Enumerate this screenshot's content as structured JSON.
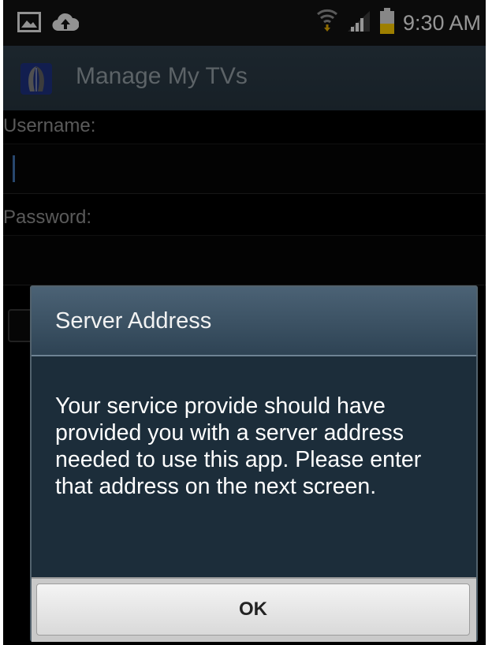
{
  "status_bar": {
    "time": "9:30 AM",
    "left_icons": [
      "gallery-icon",
      "cloud-upload-icon"
    ],
    "right_icons": [
      "wifi-icon",
      "signal-icon",
      "battery-icon"
    ]
  },
  "action_bar": {
    "title": "Manage My TVs",
    "icon": "app-icon"
  },
  "form": {
    "username_label": "Username:",
    "username_value": "",
    "password_label": "Password:",
    "password_value": ""
  },
  "dialog": {
    "title": "Server Address",
    "message": "Your service provide should have provided you with a server address needed to use this app. Please enter that address on the next screen.",
    "ok_label": "OK"
  },
  "colors": {
    "dialog_background": "#1c2d3a",
    "dialog_title_bar": "#3f5567",
    "action_bar": "#2b3a45",
    "caret": "#3e6ea8",
    "battery": "#f2c300"
  }
}
